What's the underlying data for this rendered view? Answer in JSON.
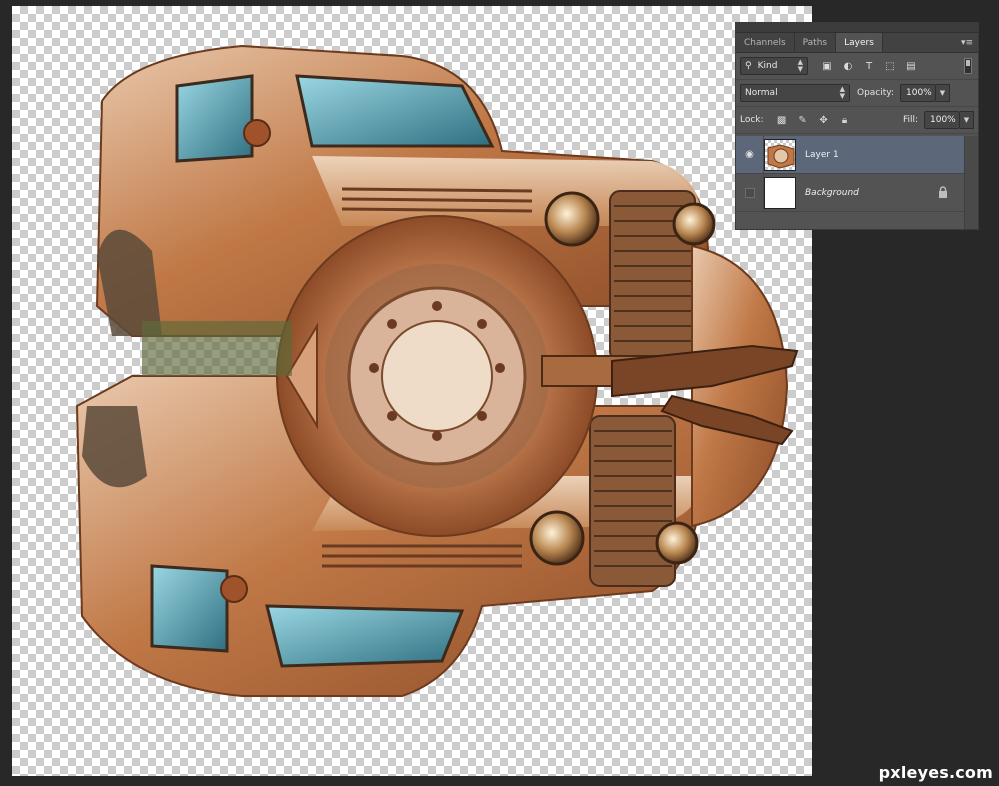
{
  "panel": {
    "tabs": [
      {
        "label": "Channels"
      },
      {
        "label": "Paths"
      },
      {
        "label": "Layers",
        "active": true
      }
    ],
    "menu_icon": "panel-menu-icon",
    "filter": {
      "kind_label": "Kind",
      "icons": [
        "image-filter-icon",
        "adjustment-filter-icon",
        "type-filter-icon",
        "shape-filter-icon",
        "smart-object-filter-icon"
      ]
    },
    "blend_mode": "Normal",
    "opacity_label": "Opacity:",
    "opacity_value": "100%",
    "lock_label": "Lock:",
    "lock_icons": [
      "lock-transparent-pixels-icon",
      "lock-image-pixels-icon",
      "lock-position-icon",
      "lock-all-icon"
    ],
    "fill_label": "Fill:",
    "fill_value": "100%",
    "layers": [
      {
        "name": "Layer 1",
        "visible": true,
        "selected": true
      },
      {
        "name": "Background",
        "visible": false,
        "locked": true
      }
    ]
  },
  "watermark": "pxleyes.com",
  "colors": {
    "workspace": "#282828",
    "panel": "#535353",
    "selected_layer": "#5d677a",
    "rust": "#b8683a"
  }
}
